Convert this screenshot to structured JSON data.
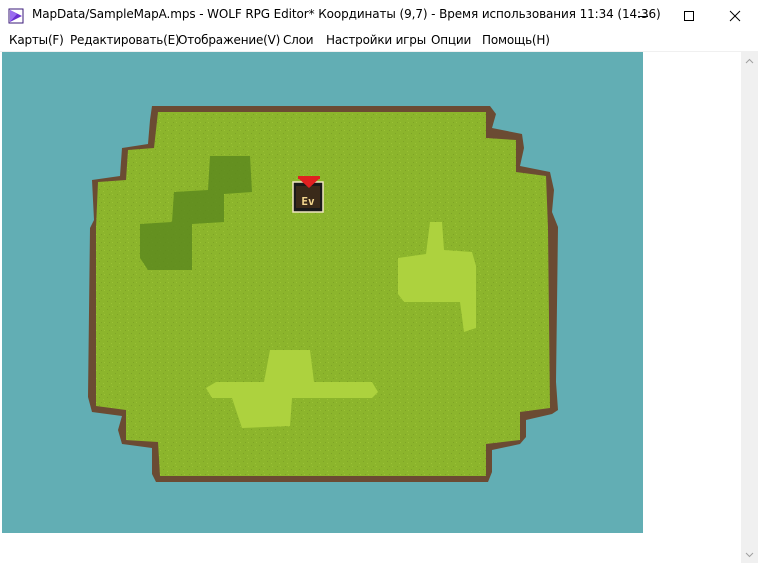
{
  "window": {
    "title": "MapData/SampleMapA.mps - WOLF RPG Editor* Координаты (9,7)  - Время использования 11:34 (14:36)",
    "icon": "wolf-rpg-app-icon",
    "controls": [
      "minimize",
      "maximize",
      "close"
    ]
  },
  "menu": {
    "items": [
      {
        "id": "maps",
        "label": "Карты(F)"
      },
      {
        "id": "edit",
        "label": "Редактировать(E)"
      },
      {
        "id": "view",
        "label": "Отображение(V)"
      },
      {
        "id": "layers",
        "label": "Слои"
      },
      {
        "id": "settings",
        "label": "Настройки игры"
      },
      {
        "id": "options",
        "label": "Опции"
      },
      {
        "id": "help",
        "label": "Помощь(H)"
      }
    ]
  },
  "map": {
    "event_marker": {
      "label": "Ev",
      "icon": "event-marker-icon",
      "arrow_icon": "red-down-arrow-icon"
    },
    "colors": {
      "water": "#62aeb4",
      "grass": "#8cb52c",
      "dark_grass": "#5d8a1f",
      "light_grass": "#add23e",
      "border": "#6b4b33"
    }
  },
  "scrollbar": {
    "up_icon": "chevron-up-icon",
    "down_icon": "chevron-down-icon"
  }
}
